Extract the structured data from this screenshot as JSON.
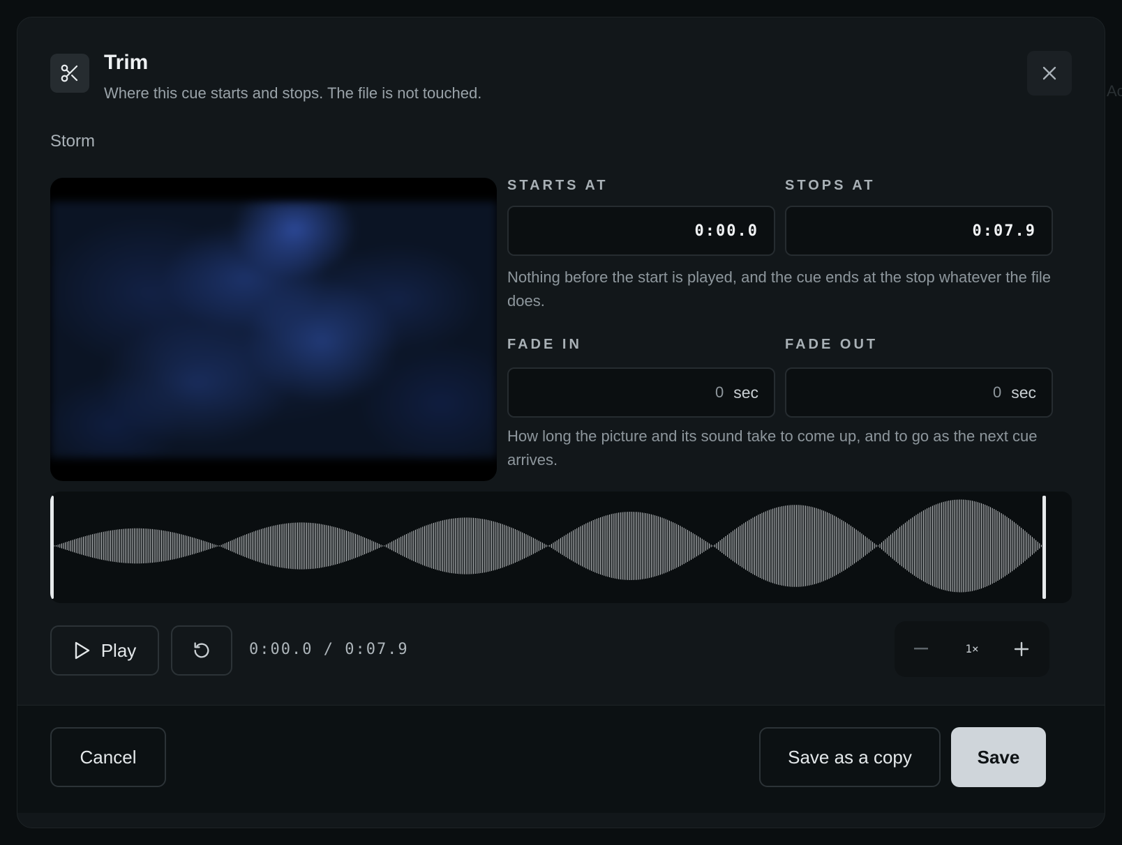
{
  "background": {
    "partial_text": "Ac"
  },
  "dialog": {
    "title": "Trim",
    "subtitle": "Where this cue starts and stops. The file is not touched.",
    "icon": "scissors-icon",
    "close_icon": "close-icon"
  },
  "cue": {
    "name": "Storm"
  },
  "trim": {
    "starts_label": "STARTS AT",
    "starts_value": "0:00.0",
    "stops_label": "STOPS AT",
    "stops_value": "0:07.9",
    "help": "Nothing before the start is played, and the cue ends at the stop whatever the file does."
  },
  "fade": {
    "in_label": "FADE IN",
    "in_value": "0",
    "out_label": "FADE OUT",
    "out_value": "0",
    "unit": "sec",
    "help": "How long the picture and its sound take to come up, and to go as the next cue arrives."
  },
  "waveform": {
    "segments": [
      0.36,
      0.48,
      0.58,
      0.7,
      0.84,
      0.95
    ],
    "color": "#c9cdd0"
  },
  "transport": {
    "play_label": "Play",
    "play_icon": "play-icon",
    "reset_icon": "restart-icon",
    "timecode": "0:00.0 / 0:07.9",
    "zoom_level": "1×",
    "zoom_out_icon": "minus-icon",
    "zoom_in_icon": "plus-icon"
  },
  "footer": {
    "cancel_label": "Cancel",
    "save_copy_label": "Save as a copy",
    "save_label": "Save"
  }
}
